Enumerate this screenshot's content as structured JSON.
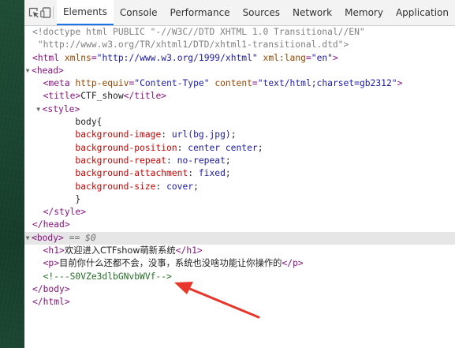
{
  "tabs": [
    {
      "label": "Elements",
      "active": true
    },
    {
      "label": "Console"
    },
    {
      "label": "Performance"
    },
    {
      "label": "Sources"
    },
    {
      "label": "Network"
    },
    {
      "label": "Memory"
    },
    {
      "label": "Application"
    }
  ],
  "toolbar_icons": [
    "inspect-element-icon",
    "device-toolbar-icon"
  ],
  "dom": {
    "doctype_line1": "<!doctype html PUBLIC \"-//W3C//DTD XHTML 1.0 Transitional//EN\"",
    "doctype_line2": "\"http://www.w3.org/TR/xhtml1/DTD/xhtml1-transitional.dtd\">",
    "html_tag": "html",
    "html_attr1_name": "xmlns",
    "html_attr1_value": "\"http://www.w3.org/1999/xhtml\"",
    "html_attr2_name": "xml:lang",
    "html_attr2_value": "\"en\"",
    "head_tag": "head",
    "meta_tag": "meta",
    "meta_attr1_name": "http-equiv",
    "meta_attr1_value": "\"Content-Type\"",
    "meta_attr2_name": "content",
    "meta_attr2_value": "\"text/html;charset=gb2312\"",
    "title_tag": "title",
    "title_text": "CTF_show",
    "style_tag": "style",
    "css": {
      "selector": "body{",
      "rules": [
        {
          "prop": "background-image",
          "value": "url(bg.jpg)"
        },
        {
          "prop": "background-position",
          "value": "center center"
        },
        {
          "prop": "background-repeat",
          "value": "no-repeat"
        },
        {
          "prop": "background-attachment",
          "value": "fixed"
        },
        {
          "prop": "background-size",
          "value": "cover"
        }
      ],
      "close": "}"
    },
    "body_tag": "body",
    "body_selected_marker": "== $0",
    "h1_tag": "h1",
    "h1_text": "欢迎进入CTFshow萌新系统",
    "p_tag": "p",
    "p_text": "目前你什么还都不会，没事，系统也没啥功能让你操作的",
    "comment": "<!---S0VZe3dlbGNvbWVf-->",
    "gutter_dots": "···"
  },
  "colors": {
    "tag": "#881280",
    "attr_name": "#994500",
    "attr_value": "#1a1aa6",
    "comment": "#236e25",
    "doctype": "#808080",
    "css_prop": "#c80000",
    "annotation_arrow": "#e8362b",
    "active_tab_underline": "#1a73e8"
  }
}
